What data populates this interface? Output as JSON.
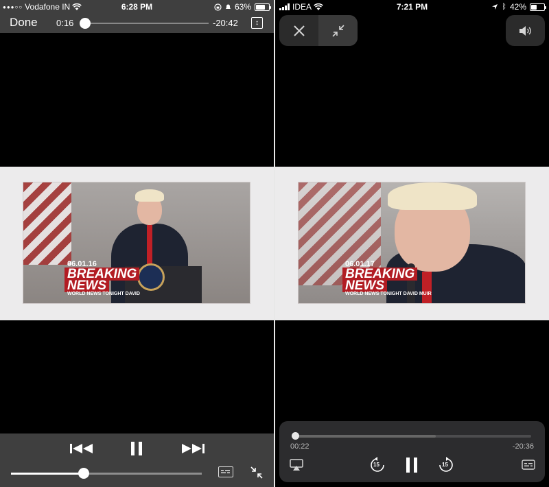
{
  "left": {
    "status": {
      "carrier": "Vodafone IN",
      "time": "6:28 PM",
      "battery_text": "63%",
      "battery_level": 0.63
    },
    "top_bar": {
      "done_label": "Done",
      "elapsed": "0:16",
      "remaining": "-20:42",
      "progress": 0.01
    },
    "video": {
      "date": "06.01.16",
      "headline_1": "BREAKING",
      "headline_2": "NEWS",
      "subline": "WORLD NEWS TONIGHT DAVID"
    },
    "volume_level": 0.38,
    "icons": [
      "skip-back-icon",
      "pause-icon",
      "skip-forward-icon",
      "captions-icon",
      "exit-fullscreen-icon",
      "aspect-ratio-icon",
      "wifi-icon",
      "signal-dots-icon"
    ]
  },
  "right": {
    "status": {
      "carrier": "IDEA",
      "time": "7:21 PM",
      "battery_text": "42%",
      "battery_level": 0.42
    },
    "video": {
      "date": "06.01.17",
      "headline_1": "BREAKING",
      "headline_2": "NEWS",
      "subline": "WORLD NEWS TONIGHT DAVID MUIR"
    },
    "player": {
      "elapsed": "00:22",
      "remaining": "-20:36",
      "progress": 0.01,
      "buffered": 0.6
    },
    "icons": [
      "close-icon",
      "shrink-icon",
      "volume-icon",
      "airplay-icon",
      "skip-back-15-icon",
      "pause-icon",
      "skip-forward-15-icon",
      "captions-icon"
    ],
    "skip_seconds": "15"
  }
}
